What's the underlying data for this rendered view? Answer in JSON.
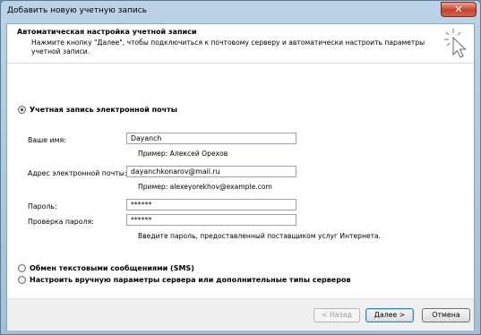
{
  "window": {
    "title": "Добавить новую учетную запись",
    "close_glyph": "✕"
  },
  "header": {
    "title": "Автоматическая настройка учетной записи",
    "description": "Нажмите кнопку \"Далее\", чтобы подключиться к почтовому серверу и автоматически настроить параметры учетной записи.",
    "icon": "cursor-sparkle-icon"
  },
  "options": {
    "email_account": {
      "label": "Учетная запись электронной почты",
      "selected": true
    },
    "sms": {
      "label": "Обмен текстовыми сообщениями (SMS)",
      "selected": false
    },
    "manual": {
      "label": "Настроить вручную параметры сервера или дополнительные типы серверов",
      "selected": false
    }
  },
  "form": {
    "name": {
      "label": "Ваше имя:",
      "value": "Dayanch",
      "hint": "Пример: Алексей Орехов"
    },
    "email": {
      "label": "Адрес электронной почты:",
      "value": "dayanchkonarov@mail.ru",
      "hint": "Пример: alexeyorekhov@example.com"
    },
    "password": {
      "label": "Пароль:",
      "value": "******"
    },
    "password_confirm": {
      "label": "Проверка пароля:",
      "value": "******",
      "hint": "Введите пароль, предоставленный поставщиком услуг Интернета."
    }
  },
  "buttons": {
    "back": "< Назад",
    "next": "Далее >",
    "cancel": "Отмена"
  }
}
